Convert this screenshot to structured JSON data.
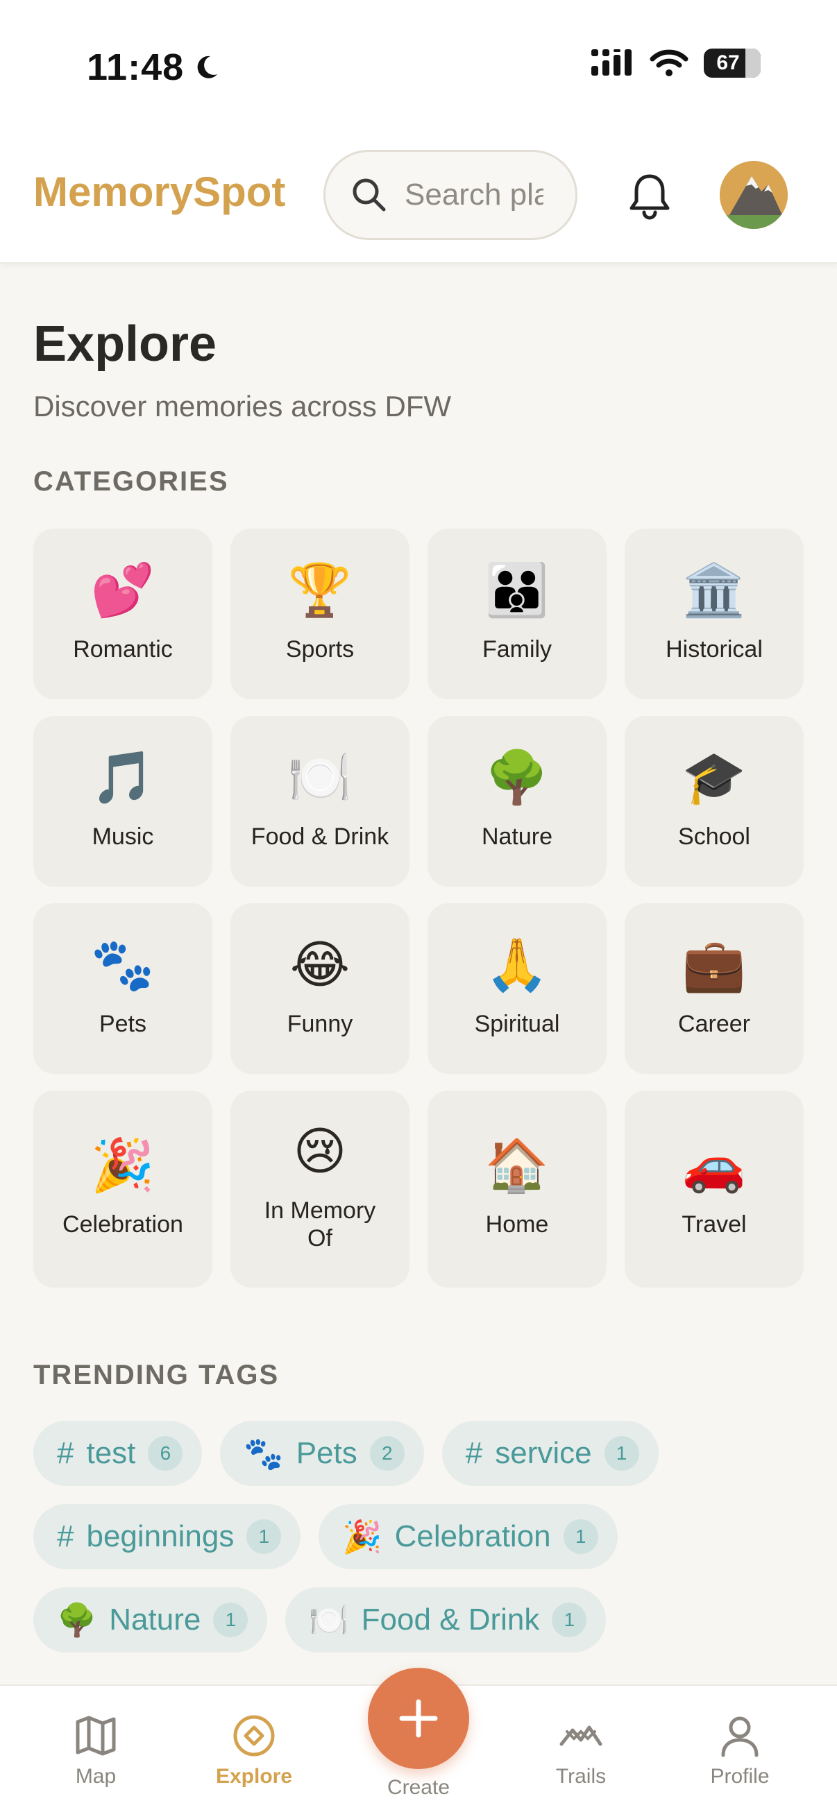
{
  "status": {
    "time": "11:48",
    "battery": "67"
  },
  "header": {
    "brand": "MemorySpot",
    "search_placeholder": "Search places"
  },
  "main": {
    "title": "Explore",
    "subtitle": "Discover memories across DFW",
    "categories_label": "CATEGORIES",
    "categories": [
      {
        "icon": "💕",
        "label": "Romantic"
      },
      {
        "icon": "🏆",
        "label": "Sports"
      },
      {
        "icon": "👪",
        "label": "Family"
      },
      {
        "icon": "🏛️",
        "label": "Historical"
      },
      {
        "icon": "🎵",
        "label": "Music"
      },
      {
        "icon": "🍽️",
        "label": "Food & Drink"
      },
      {
        "icon": "🌳",
        "label": "Nature"
      },
      {
        "icon": "🎓",
        "label": "School"
      },
      {
        "icon": "🐾",
        "label": "Pets"
      },
      {
        "icon": "😂",
        "label": "Funny"
      },
      {
        "icon": "🙏",
        "label": "Spiritual"
      },
      {
        "icon": "💼",
        "label": "Career"
      },
      {
        "icon": "🎉",
        "label": "Celebration"
      },
      {
        "icon": "😢",
        "label": "In Memory Of"
      },
      {
        "icon": "🏠",
        "label": "Home"
      },
      {
        "icon": "🚗",
        "label": "Travel"
      }
    ],
    "tags_label": "TRENDING TAGS",
    "tags": [
      {
        "prefix": "#",
        "label": "test",
        "count": "6"
      },
      {
        "prefix": "🐾",
        "label": "Pets",
        "count": "2"
      },
      {
        "prefix": "#",
        "label": "service",
        "count": "1"
      },
      {
        "prefix": "#",
        "label": "beginnings",
        "count": "1"
      },
      {
        "prefix": "🎉",
        "label": "Celebration",
        "count": "1"
      },
      {
        "prefix": "🌳",
        "label": "Nature",
        "count": "1"
      },
      {
        "prefix": "🍽️",
        "label": "Food & Drink",
        "count": "1"
      }
    ]
  },
  "nav": {
    "map": "Map",
    "explore": "Explore",
    "create": "Create",
    "trails": "Trails",
    "profile": "Profile"
  },
  "colors": {
    "brand": "#d4a24e",
    "accent": "#e07a4f",
    "tag_text": "#4a9a9a"
  }
}
